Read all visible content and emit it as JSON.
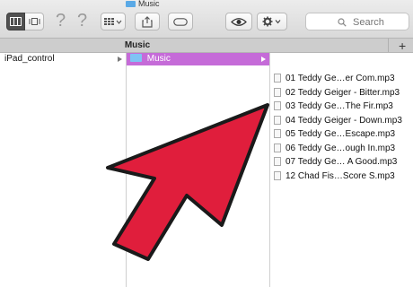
{
  "window": {
    "current_folder_title": "Music",
    "icons": {
      "folder": "folder-icon"
    }
  },
  "toolbar": {
    "view_buttons": [
      "column-view",
      "cover-flow-view"
    ],
    "help_glyph_1": "?",
    "help_glyph_2": "?",
    "arrange_icon": "grid-icon",
    "share_icon": "share-icon",
    "tag_icon": "tag-icon",
    "quicklook_icon": "eye-icon",
    "action_icon": "gear-icon",
    "search_placeholder": "Search"
  },
  "path_bar": {
    "tab_label": "Music",
    "new_tab_glyph": "+"
  },
  "columns": {
    "col1": [
      {
        "label": "iPad_control",
        "has_children": true
      }
    ],
    "col2": [
      {
        "label": "Music",
        "selected": true,
        "has_children": true
      }
    ],
    "col3": [
      "01 Teddy Ge…er Com.mp3",
      "02 Teddy Geiger - Bitter.mp3",
      "03 Teddy Ge…The Fir.mp3",
      "04 Teddy Geiger - Down.mp3",
      "05 Teddy Ge…Escape.mp3",
      "06 Teddy Ge…ough In.mp3",
      "07 Teddy Ge… A Good.mp3",
      "12 Chad Fis…Score S.mp3"
    ]
  },
  "colors": {
    "selection": "#c56bd8",
    "arrow_fill": "#e01e3c",
    "arrow_stroke": "#1a1a1a"
  }
}
